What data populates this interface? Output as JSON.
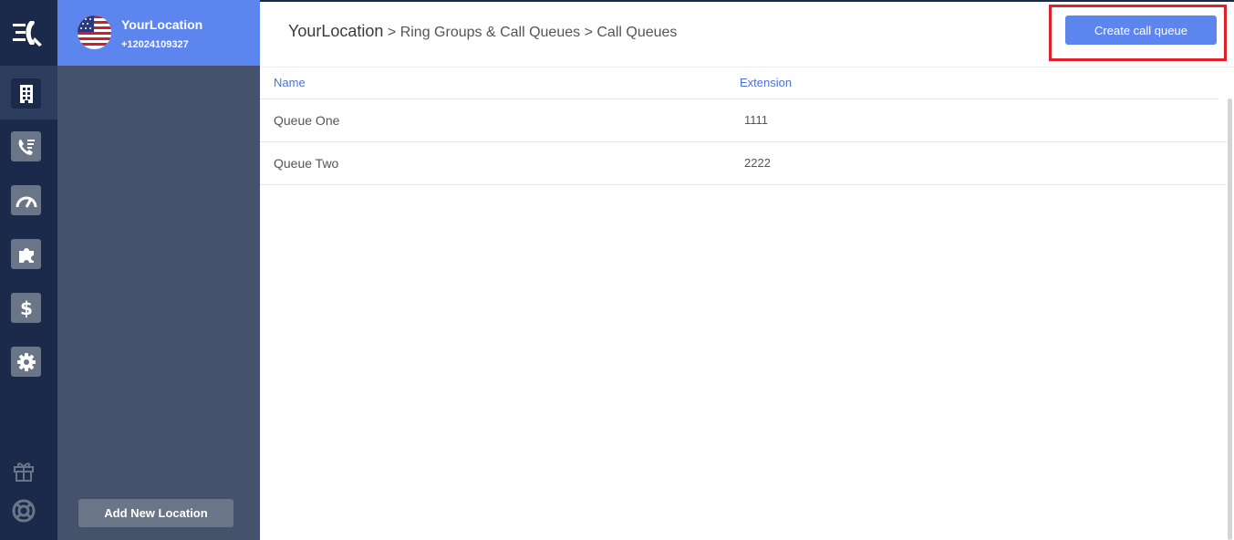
{
  "rail": {
    "items": [
      {
        "icon": "building-icon",
        "active": true
      },
      {
        "icon": "phone-list-icon",
        "active": false
      },
      {
        "icon": "speedometer-icon",
        "active": false
      },
      {
        "icon": "puzzle-icon",
        "active": false
      },
      {
        "icon": "dollar-icon",
        "active": false
      },
      {
        "icon": "gear-icon",
        "active": false
      }
    ],
    "footer": [
      "gift-icon",
      "lifebuoy-icon"
    ]
  },
  "location": {
    "name": "YourLocation",
    "phone": "+12024109327",
    "add_label": "Add New Location"
  },
  "breadcrumb": {
    "root": "YourLocation",
    "sep": ">",
    "level1": "Ring Groups & Call Queues",
    "level2": "Call Queues"
  },
  "actions": {
    "create_label": "Create call queue"
  },
  "table": {
    "columns": [
      "Name",
      "Extension"
    ],
    "rows": [
      {
        "name": "Queue One",
        "extension": "1111"
      },
      {
        "name": "Queue Two",
        "extension": "2222"
      }
    ]
  },
  "colors": {
    "rail": "#1b2a4a",
    "panel": "#46516b",
    "accent": "#5c86ee",
    "highlight": "#e0202a"
  }
}
